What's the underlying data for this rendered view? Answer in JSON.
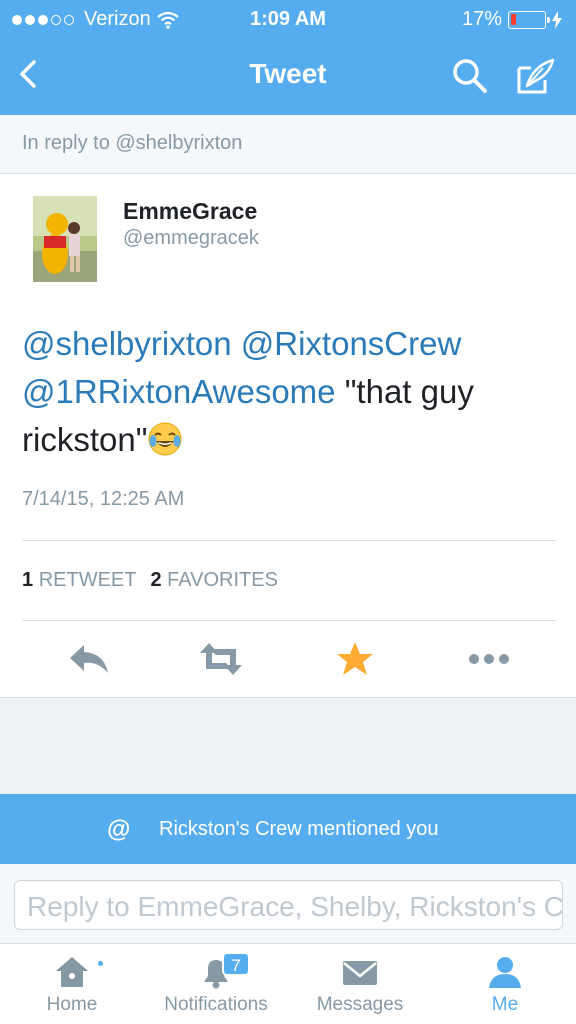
{
  "status_bar": {
    "carrier": "Verizon",
    "time": "1:09 AM",
    "battery_percent": "17%",
    "battery_level": 0.17,
    "signal_bars": 3
  },
  "nav": {
    "title": "Tweet",
    "back_icon": "chevron-left-icon",
    "search_icon": "search-icon",
    "compose_icon": "compose-icon"
  },
  "reply_context": "In reply to @shelbyrixton",
  "tweet": {
    "author_name": "EmmeGrace",
    "author_handle": "@emmegracek",
    "mentions": [
      "@shelbyrixton",
      "@RixtonsCrew",
      "@1RRixtonAwesome"
    ],
    "body": "\"that guy rickston\"",
    "emoji": "tears-of-joy-emoji",
    "timestamp": "7/14/15, 12:25 AM",
    "retweet_count": "1",
    "retweet_label": "RETWEET",
    "favorite_count": "2",
    "favorite_label": "FAVORITES"
  },
  "actions": {
    "reply_icon": "reply-icon",
    "retweet_icon": "retweet-icon",
    "favorite_icon": "star-icon",
    "more_icon": "more-icon"
  },
  "notification_banner": {
    "icon": "@",
    "text": "Rickston's Crew mentioned you"
  },
  "reply_box": {
    "placeholder": "Reply to EmmeGrace, Shelby, Rickston's Crew"
  },
  "tab_bar": {
    "tabs": [
      {
        "label": "Home",
        "icon": "home-icon"
      },
      {
        "label": "Notifications",
        "icon": "bell-icon",
        "badge": "7"
      },
      {
        "label": "Messages",
        "icon": "envelope-icon"
      },
      {
        "label": "Me",
        "icon": "person-icon",
        "active": true
      }
    ]
  },
  "colors": {
    "brand_blue": "#55acee",
    "link_blue": "#2b7bb9",
    "star_orange": "#ffac33",
    "muted_gray": "#8899a6"
  }
}
